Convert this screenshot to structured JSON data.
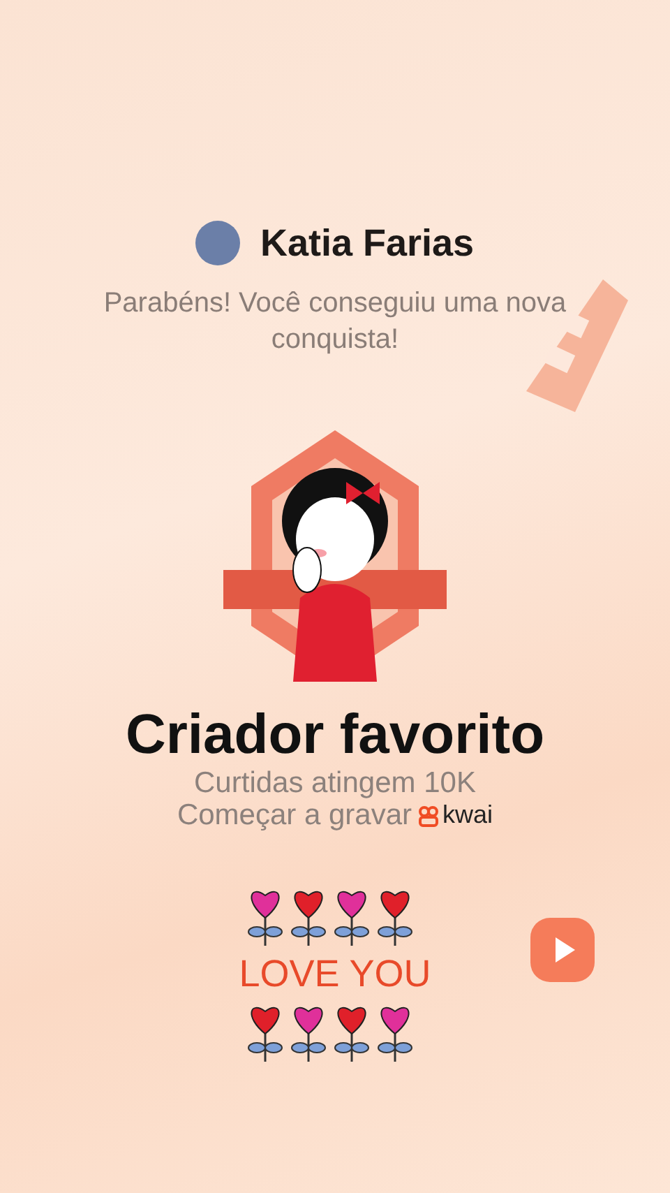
{
  "profile": {
    "name": "Katia Farias"
  },
  "message": "Parabéns! Você conseguiu uma nova conquista!",
  "achievement": {
    "title": "Criador favorito",
    "condition": "Curtidas atingem 10K",
    "cta": "Começar a gravar",
    "brand": "kwai"
  },
  "sticker": {
    "text": "LOVE YOU"
  }
}
